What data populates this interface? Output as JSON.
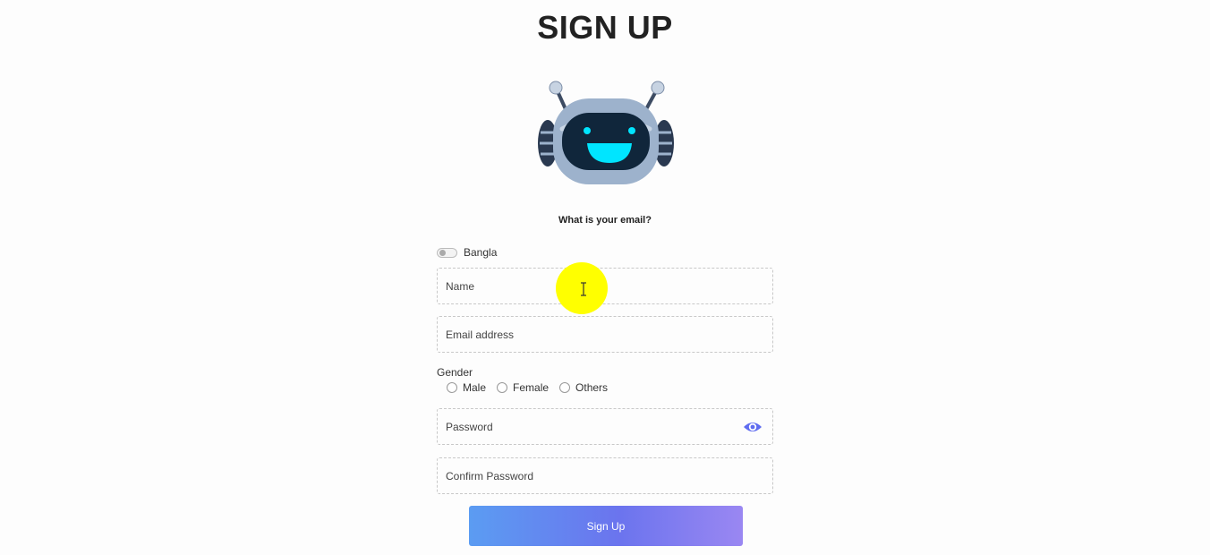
{
  "page": {
    "title": "SIGN UP",
    "prompt": "What is your email?"
  },
  "language_toggle": {
    "label": "Bangla",
    "checked": false
  },
  "form": {
    "name_placeholder": "Name",
    "email_placeholder": "Email address",
    "gender_label": "Gender",
    "gender_options": [
      "Male",
      "Female",
      "Others"
    ],
    "password_placeholder": "Password",
    "confirm_password_placeholder": "Confirm Password",
    "submit_label": "Sign Up"
  },
  "icons": {
    "robot": "robot-mascot-icon",
    "eye": "eye-icon"
  },
  "colors": {
    "robot_face": "#0a8fa0",
    "robot_eyes": "#00e5ff",
    "robot_shell": "#9db2cc",
    "eye_icon": "#5f6cf0",
    "button_gradient_start": "#5b9cf2",
    "button_gradient_end": "#9a87f2",
    "cursor_highlight": "#ffff00"
  }
}
